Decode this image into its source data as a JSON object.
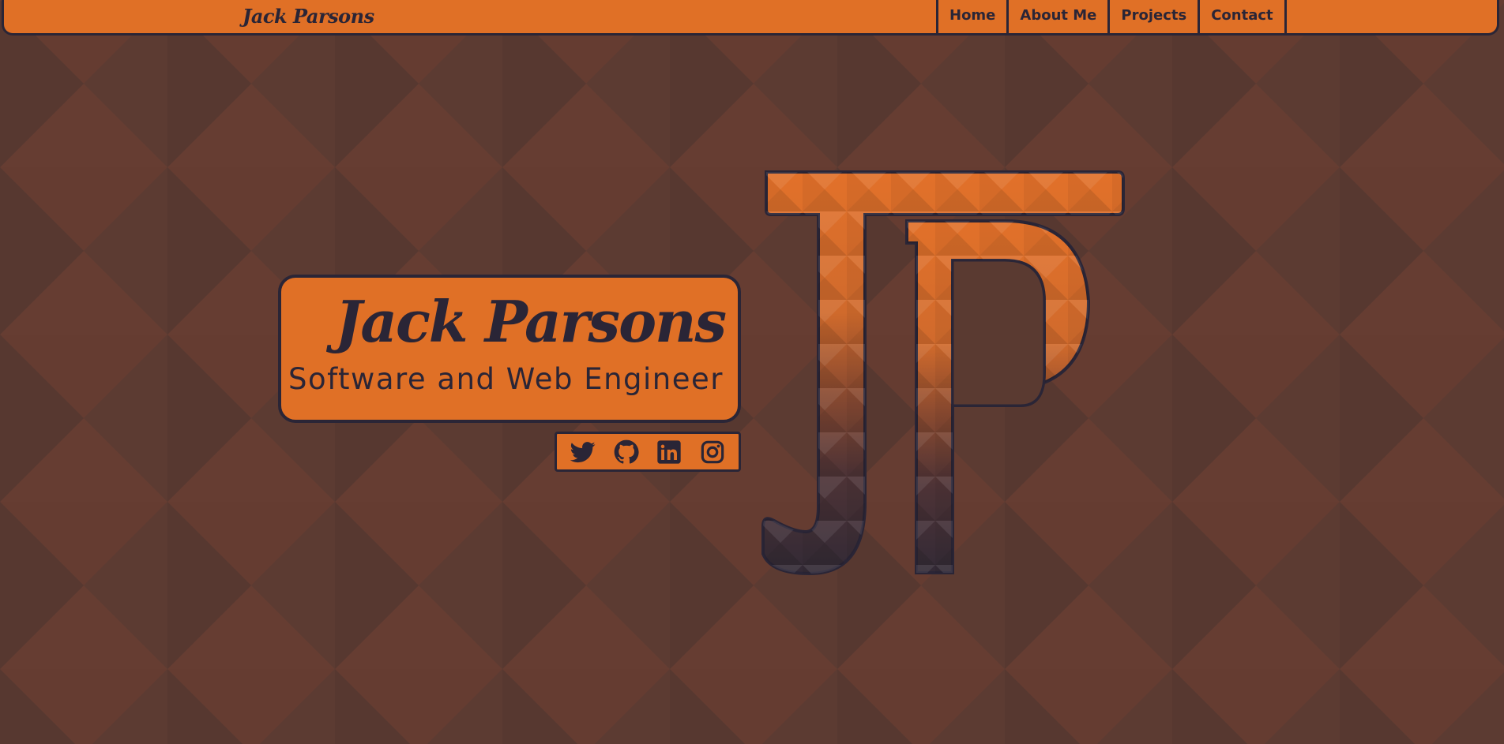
{
  "colors": {
    "accent": "#e07026",
    "dark": "#2a2536",
    "background": "#5a3a31",
    "background_light": "#653c31"
  },
  "navbar": {
    "brand": "Jack Parsons",
    "links": [
      {
        "label": "Home"
      },
      {
        "label": "About Me"
      },
      {
        "label": "Projects"
      },
      {
        "label": "Contact"
      }
    ]
  },
  "hero": {
    "name": "Jack Parsons",
    "subtitle": "Software and Web Engineer"
  },
  "social": [
    {
      "icon": "twitter-icon"
    },
    {
      "icon": "github-icon"
    },
    {
      "icon": "linkedin-icon"
    },
    {
      "icon": "instagram-icon"
    }
  ],
  "monogram": {
    "letters": "JP"
  }
}
